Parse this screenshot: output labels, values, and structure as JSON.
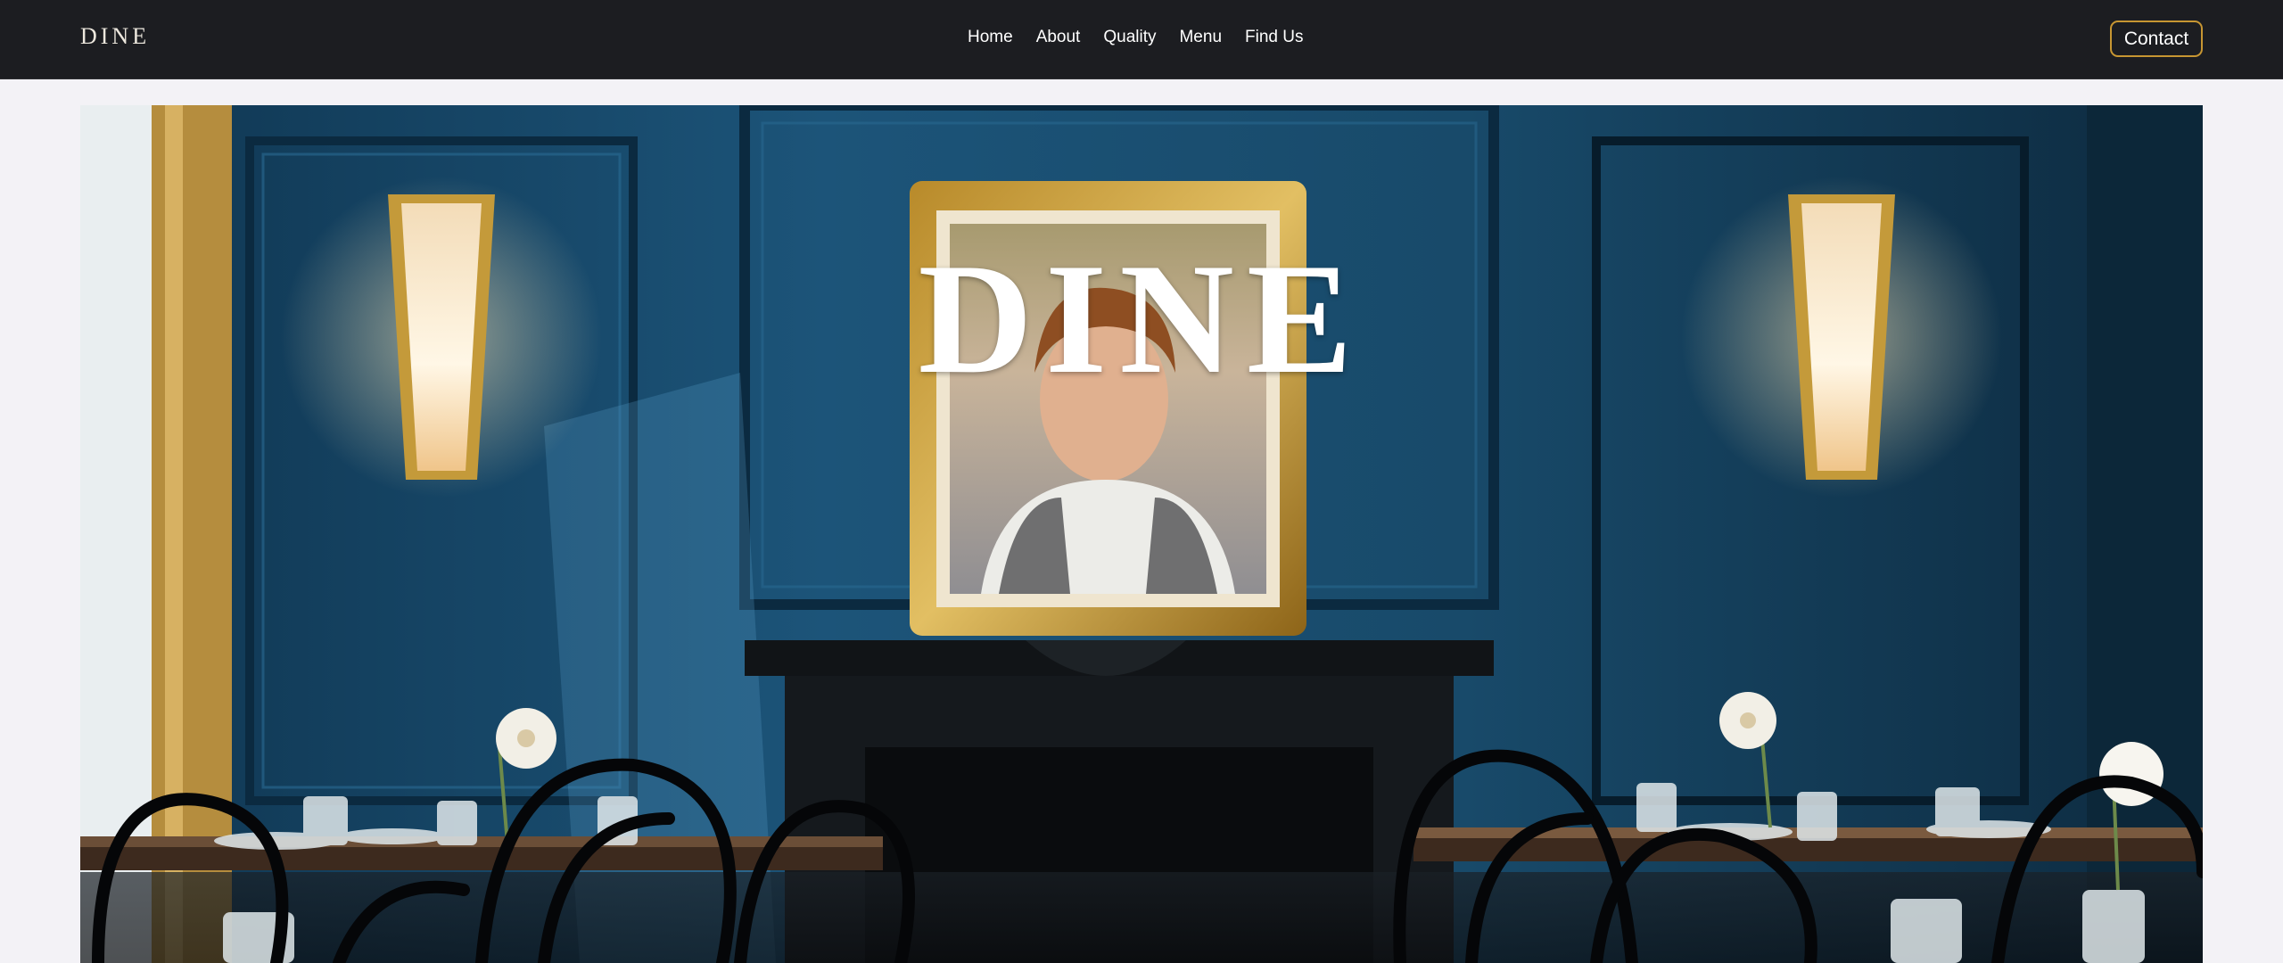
{
  "nav": {
    "brand": "DINE",
    "links": [
      "Home",
      "About",
      "Quality",
      "Menu",
      "Find Us"
    ],
    "contact_label": "Contact"
  },
  "hero": {
    "title": "DINE",
    "image_description_icon": "restaurant-interior-photo"
  },
  "colors": {
    "navbar_bg": "#1c1d21",
    "page_bg": "#f3f2f6",
    "accent": "#c79632",
    "wall": "#1b4a6b"
  }
}
